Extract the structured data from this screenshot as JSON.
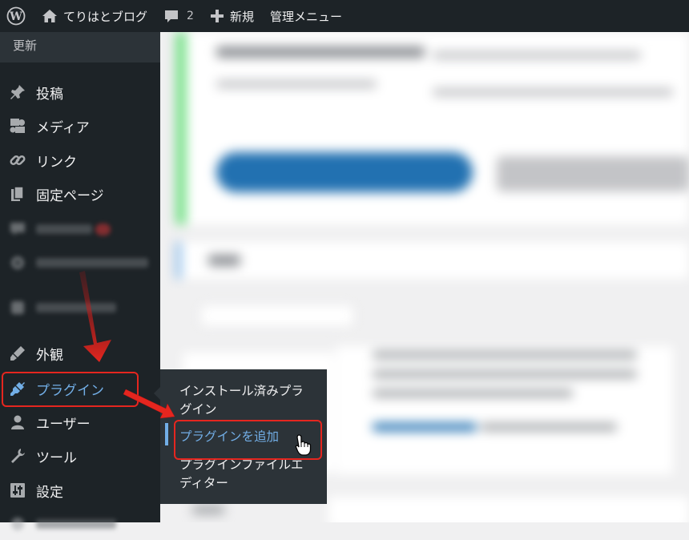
{
  "admin_bar": {
    "site_name": "てりはとブログ",
    "comments_count": "2",
    "new_label": "新規",
    "admin_menu_label": "管理メニュー"
  },
  "sidebar": {
    "update_label": "更新",
    "items": [
      {
        "label": "投稿",
        "icon": "pin-icon"
      },
      {
        "label": "メディア",
        "icon": "media-icon"
      },
      {
        "label": "リンク",
        "icon": "link-icon"
      },
      {
        "label": "固定ページ",
        "icon": "pages-icon"
      },
      {
        "label": "",
        "icon": "comments-icon"
      },
      {
        "label": "",
        "icon": "settings-icon"
      },
      {
        "label": "",
        "icon": "blurred-icon"
      },
      {
        "label": "外観",
        "icon": "appearance-icon"
      },
      {
        "label": "プラグイン",
        "icon": "plugin-icon"
      },
      {
        "label": "ユーザー",
        "icon": "users-icon"
      },
      {
        "label": "ツール",
        "icon": "tools-icon"
      },
      {
        "label": "設定",
        "icon": "settings-sliders-icon"
      }
    ]
  },
  "flyout": {
    "items": [
      {
        "label": "インストール済みプラグイン"
      },
      {
        "label": "プラグインを追加"
      },
      {
        "label": "プラグインファイルエディター"
      }
    ]
  },
  "colors": {
    "admin_dark": "#1d2327",
    "submenu_bg": "#2c3338",
    "accent_blue": "#72aee6",
    "annotation_red": "#e5261f"
  }
}
